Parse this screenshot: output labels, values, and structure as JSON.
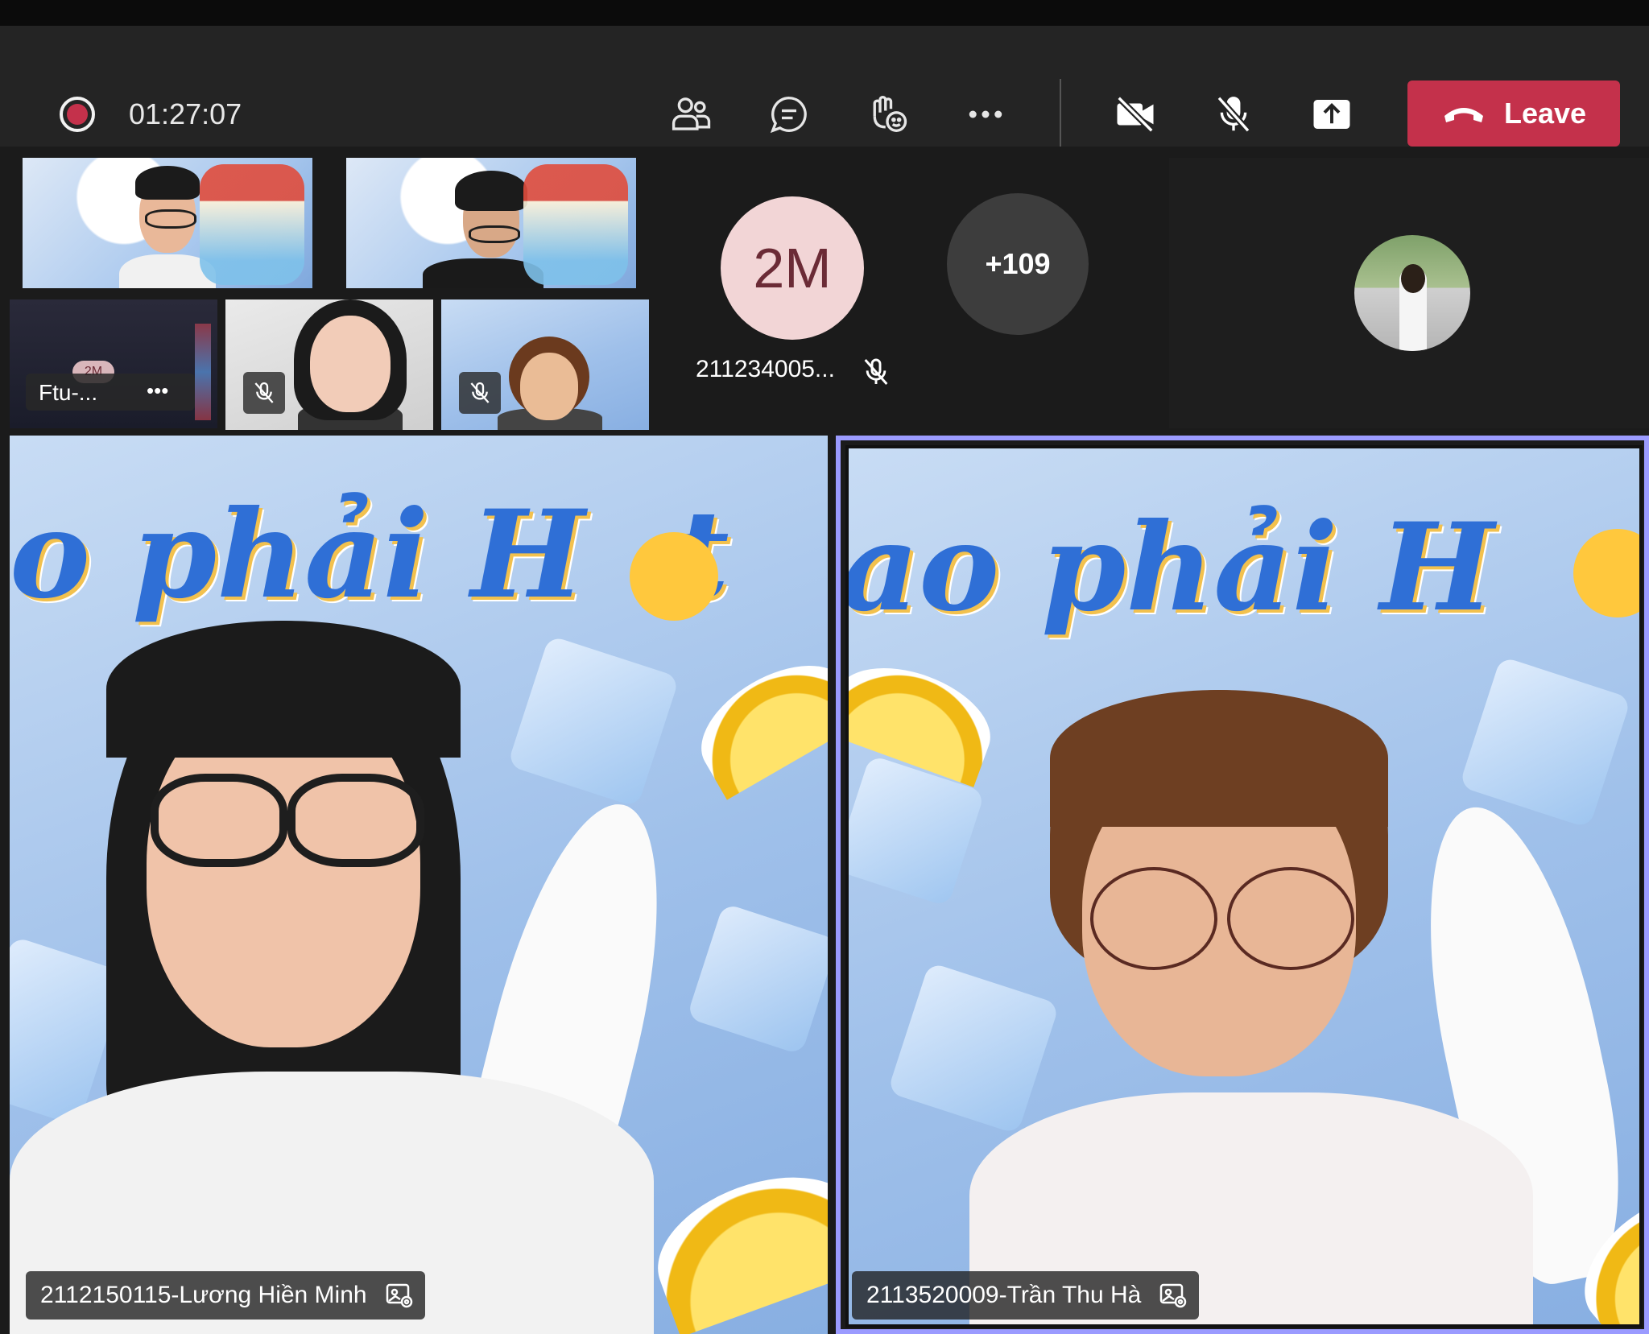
{
  "toolbar": {
    "timer": "01:27:07",
    "leave_label": "Leave",
    "icons": [
      "record-icon",
      "people-icon",
      "chat-icon",
      "reactions-icon",
      "more-icon",
      "camera-off-icon",
      "mic-off-icon",
      "share-icon",
      "phone-icon"
    ]
  },
  "thumbnails": {
    "ftu_name": "Ftu-...",
    "ftu_badge": "2M",
    "ftu_more": "•••"
  },
  "attendees": {
    "avatar_2m_initials": "2M",
    "avatar_2m_name": "211234005...",
    "overflow_count": "+109"
  },
  "main": {
    "left_name": "2112150115-Lương Hiền Minh",
    "right_name": "2113520009-Trần Thu Hà",
    "banner_left": "o phải H",
    "banner_left_end": "t",
    "banner_right": "ao phải H"
  },
  "colors": {
    "leave": "#c4314b",
    "selected_border": "#9b9bff",
    "toolbar_bg": "#242424"
  }
}
